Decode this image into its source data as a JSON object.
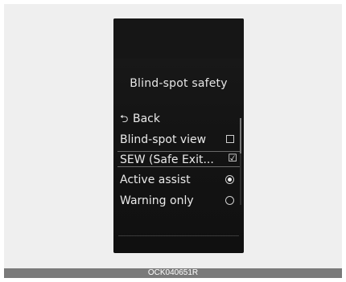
{
  "screen": {
    "title": "Blind-spot safety",
    "menu": {
      "back": {
        "label": "Back",
        "icon": "back-arrow-icon"
      },
      "items": [
        {
          "label": "Blind-spot view",
          "control": "checkbox",
          "checked": false
        },
        {
          "label": "SEW (Safe Exit...",
          "control": "checkbox",
          "checked": true,
          "highlighted": true
        },
        {
          "label": "Active assist",
          "control": "radio",
          "selected": true
        },
        {
          "label": "Warning only",
          "control": "radio",
          "selected": false
        }
      ]
    }
  },
  "caption": {
    "code": "OCK040651R"
  },
  "colors": {
    "screen_background": "#141414",
    "text": "#eaeaea",
    "caption_bar": "#7a7a7a",
    "frame": "#efefef"
  }
}
